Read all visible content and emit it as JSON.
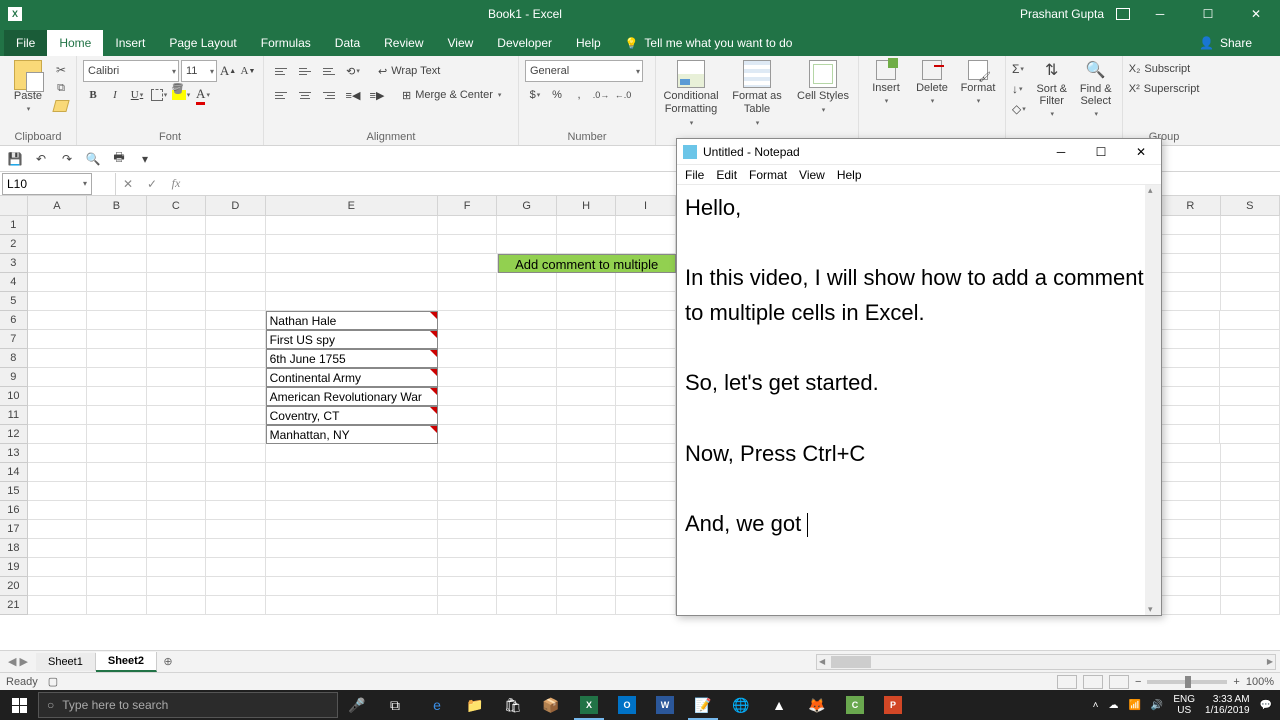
{
  "app": {
    "title": "Book1 - Excel",
    "user": "Prashant Gupta"
  },
  "tabs": {
    "file": "File",
    "home": "Home",
    "insert": "Insert",
    "page_layout": "Page Layout",
    "formulas": "Formulas",
    "data": "Data",
    "review": "Review",
    "view": "View",
    "developer": "Developer",
    "help": "Help",
    "tellme": "Tell me what you want to do",
    "share": "Share"
  },
  "ribbon": {
    "clipboard": {
      "label": "Clipboard",
      "paste": "Paste"
    },
    "font": {
      "label": "Font",
      "name": "Calibri",
      "size": "11"
    },
    "alignment": {
      "label": "Alignment",
      "wrap": "Wrap Text",
      "merge": "Merge & Center"
    },
    "number": {
      "label": "Number",
      "format": "General"
    },
    "styles": {
      "cf": "Conditional Formatting",
      "fat": "Format as Table",
      "cs": "Cell Styles"
    },
    "cells": {
      "insert": "Insert",
      "delete": "Delete",
      "format": "Format"
    },
    "editing": {
      "sort": "Sort & Filter",
      "find": "Find & Select"
    },
    "custom": {
      "sub": "Subscript",
      "sup": "Superscript",
      "group": "Group"
    }
  },
  "namebox": "L10",
  "grid": {
    "columns": [
      "A",
      "B",
      "C",
      "D",
      "E",
      "F",
      "G",
      "H",
      "I",
      "",
      "R",
      "S"
    ],
    "banner": "Add comment to multiple",
    "data": [
      "Nathan Hale",
      "First US spy",
      "6th June 1755",
      "Continental Army",
      "American Revolutionary War",
      "Coventry, CT",
      "Manhattan, NY"
    ]
  },
  "sheets": {
    "s1": "Sheet1",
    "s2": "Sheet2"
  },
  "status": {
    "ready": "Ready",
    "zoom": "100%"
  },
  "notepad": {
    "title": "Untitled - Notepad",
    "menu": {
      "file": "File",
      "edit": "Edit",
      "format": "Format",
      "view": "View",
      "help": "Help"
    },
    "body": "Hello,\n\nIn this video, I will show how to add a comment to multiple cells in Excel.\n\nSo, let's get started.\n\nNow, Press Ctrl+C \n\nAnd, we got "
  },
  "taskbar": {
    "search_placeholder": "Type here to search",
    "lang": "ENG",
    "kbd": "US",
    "time": "3:33 AM",
    "date": "1/16/2019"
  }
}
